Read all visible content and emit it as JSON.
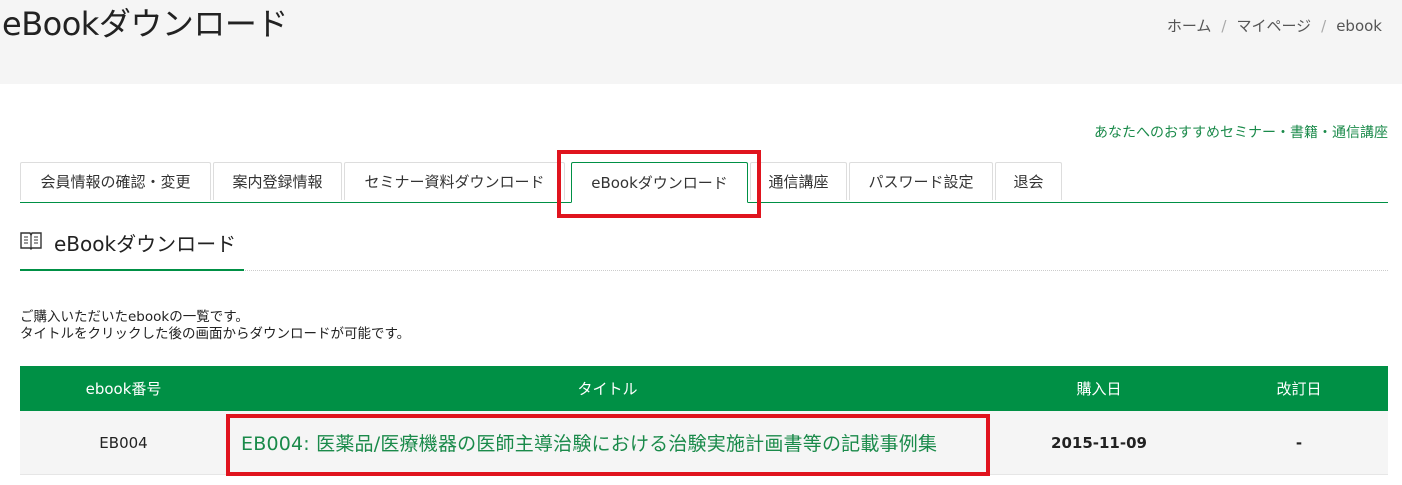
{
  "header": {
    "title": "eBookダウンロード",
    "breadcrumb": [
      "ホーム",
      "マイページ",
      "ebook"
    ],
    "separator": "/"
  },
  "recommend_link": "あなたへのおすすめセミナー・書籍・通信講座",
  "tabs": [
    {
      "label": "会員情報の確認・変更",
      "active": false
    },
    {
      "label": "案内登録情報",
      "active": false
    },
    {
      "label": "セミナー資料ダウンロード",
      "active": false
    },
    {
      "label": "eBookダウンロード",
      "active": true
    },
    {
      "label": "通信講座",
      "active": false
    },
    {
      "label": "パスワード設定",
      "active": false
    },
    {
      "label": "退会",
      "active": false
    }
  ],
  "section": {
    "icon": "book-icon",
    "title": "eBookダウンロード"
  },
  "description": {
    "line1": "ご購入いただいたebookの一覧です。",
    "line2": "タイトルをクリックした後の画面からダウンロードが可能です。"
  },
  "table": {
    "headers": [
      "ebook番号",
      "タイトル",
      "購入日",
      "改訂日"
    ],
    "rows": [
      {
        "number": "EB004",
        "title": "EB004: 医薬品/医療機器の医師主導治験における治験実施計画書等の記載事例集",
        "purchase_date": "2015-11-09",
        "revision_date": "-"
      }
    ]
  },
  "colors": {
    "accent": "#009045",
    "link": "#1a8a4a",
    "highlight": "#e0141e"
  }
}
